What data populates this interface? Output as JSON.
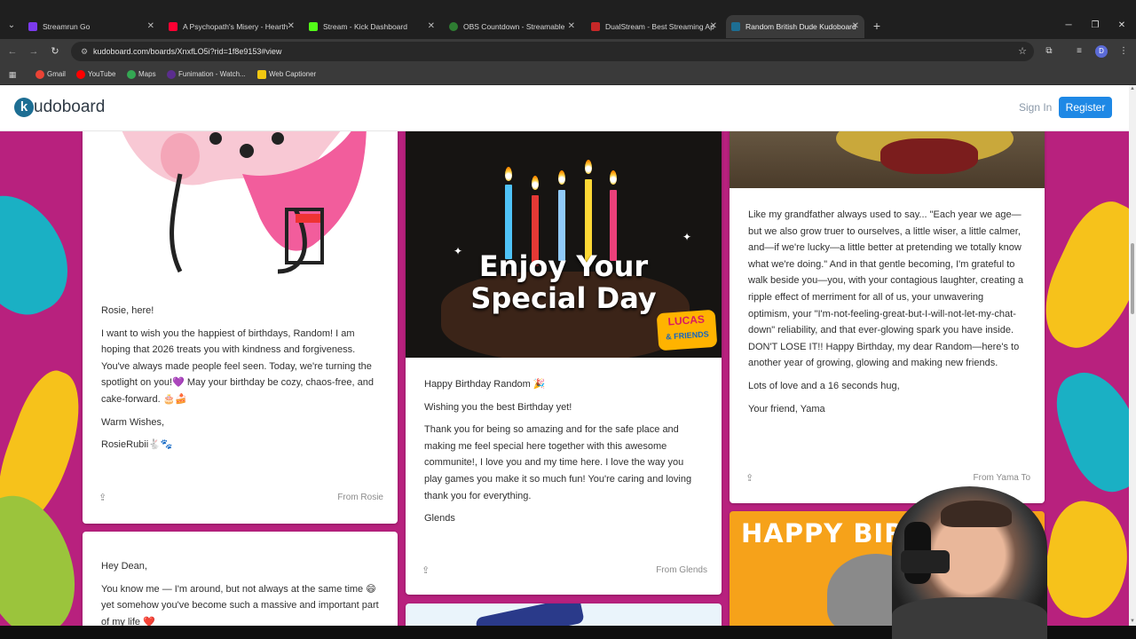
{
  "browser": {
    "tabs": [
      {
        "title": "Streamrun Go",
        "color": "#7c3aed"
      },
      {
        "title": "A Psychopath's Misery - Hearth",
        "color": "#ff0033"
      },
      {
        "title": "Stream - Kick Dashboard",
        "color": "#53fc18"
      },
      {
        "title": "OBS Countdown - Streamable",
        "color": "#2e7d32"
      },
      {
        "title": "DualStream - Best Streaming Ap",
        "color": "#c62828"
      },
      {
        "title": "Random British Dude Kudoboard",
        "color": "#1d6e93"
      }
    ],
    "url": "kudoboard.com/boards/XnxfLO5i?rid=1f8e9153#view",
    "bookmarks": [
      {
        "label": "Gmail",
        "color": "#ea4335"
      },
      {
        "label": "YouTube",
        "color": "#ff0000"
      },
      {
        "label": "Maps",
        "color": "#34a853"
      },
      {
        "label": "Funimation - Watch...",
        "color": "#5b2d8e"
      },
      {
        "label": "Web Captioner",
        "color": "#f2c811"
      }
    ],
    "profile_initial": "D"
  },
  "site": {
    "logo_letter": "k",
    "logo_text": "udoboard",
    "sign_in": "Sign In",
    "register": "Register",
    "brand_color": "#1e88e5"
  },
  "cards": {
    "rosie": {
      "greeting": "Rosie, here!",
      "body": "I want to wish you the happiest of birthdays, Random! I am hoping that 2026 treats you with kindness and forgiveness. You've always made people feel seen. Today, we're turning the spotlight on you!💜 May your birthday be cozy, chaos-free, and cake-forward. 🎂🍰",
      "closing": "Warm Wishes,",
      "signature": "RosieRubii🐇🐾",
      "from": "From Rosie"
    },
    "glends": {
      "gif_text_line1": "Enjoy Your",
      "gif_text_line2": "Special Day",
      "gif_brand_top": "LUCAS",
      "gif_brand_bottom": "& FRIENDS",
      "line1": "Happy Birthday Random 🎉",
      "line2": "Wishing you the best Birthday yet!",
      "body": "Thank you for being so amazing and for the safe place and making me feel special here together with this awesome communite!, I love you and my time here. I love the way you play games you make it so much fun! You're caring and loving thank you for everything.",
      "signature": "Glends",
      "from": "From Glends"
    },
    "yama": {
      "body": "Like my grandfather always used to say... \"Each year we age—but we also grow truer to ourselves, a little wiser, a little calmer, and—if we're lucky—a little better at pretending we totally know what we're doing.\" And in that gentle becoming, I'm grateful to walk beside you—you, with your contagious laughter, creating a ripple effect of merriment for all of us, your unwavering optimism, your \"I'm-not-feeling-great-but-I-will-not-let-my-chat-down\" reliability, and that ever-glowing spark you have inside. DON'T LOSE IT!! Happy Birthday, my dear Random—here's to another year of growing, glowing and making new friends.",
      "line2": "Lots of love and a 16 seconds hug,",
      "signature": "Your friend, Yama",
      "from": "From Yama To"
    },
    "dean": {
      "greeting": "Hey Dean,",
      "body": "You know me — I'm around, but not always at the same time 😄 yet somehow you've become such a massive and important part of my life ❤️"
    },
    "cat": {
      "gif_text": "HAPPY BIRTHDAY"
    }
  }
}
